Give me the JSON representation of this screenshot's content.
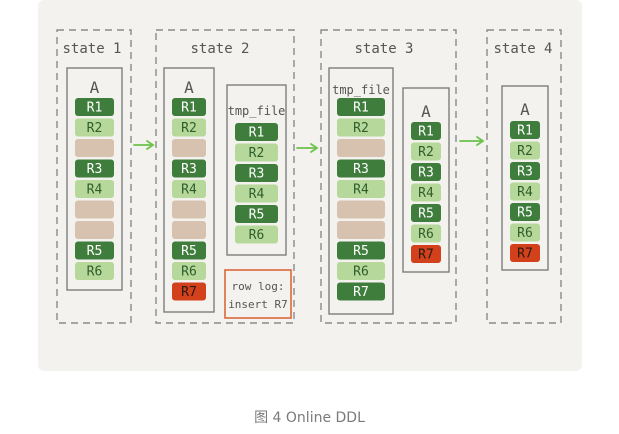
{
  "states": [
    {
      "label": "state 1"
    },
    {
      "label": "state 2"
    },
    {
      "label": "state 3"
    },
    {
      "label": "state 4"
    }
  ],
  "tables": [
    {
      "title": "A",
      "rows": [
        {
          "text": "R1",
          "kind": "dark"
        },
        {
          "text": "R2",
          "kind": "light"
        },
        {
          "text": "",
          "kind": "hole"
        },
        {
          "text": "R3",
          "kind": "dark"
        },
        {
          "text": "R4",
          "kind": "light"
        },
        {
          "text": "",
          "kind": "hole"
        },
        {
          "text": "",
          "kind": "hole"
        },
        {
          "text": "R5",
          "kind": "dark"
        },
        {
          "text": "R6",
          "kind": "light"
        }
      ]
    },
    {
      "title": "A",
      "rows": [
        {
          "text": "R1",
          "kind": "dark"
        },
        {
          "text": "R2",
          "kind": "light"
        },
        {
          "text": "",
          "kind": "hole"
        },
        {
          "text": "R3",
          "kind": "dark"
        },
        {
          "text": "R4",
          "kind": "light"
        },
        {
          "text": "",
          "kind": "hole"
        },
        {
          "text": "",
          "kind": "hole"
        },
        {
          "text": "R5",
          "kind": "dark"
        },
        {
          "text": "R6",
          "kind": "light"
        },
        {
          "text": "R7",
          "kind": "new"
        }
      ]
    },
    {
      "title": "tmp_file",
      "rows": [
        {
          "text": "R1",
          "kind": "dark"
        },
        {
          "text": "R2",
          "kind": "light"
        },
        {
          "text": "R3",
          "kind": "dark"
        },
        {
          "text": "R4",
          "kind": "light"
        },
        {
          "text": "R5",
          "kind": "dark"
        },
        {
          "text": "R6",
          "kind": "light"
        }
      ]
    },
    {
      "title": "tmp_file",
      "rows": [
        {
          "text": "R1",
          "kind": "dark"
        },
        {
          "text": "R2",
          "kind": "light"
        },
        {
          "text": "",
          "kind": "hole"
        },
        {
          "text": "R3",
          "kind": "dark"
        },
        {
          "text": "R4",
          "kind": "light"
        },
        {
          "text": "",
          "kind": "hole"
        },
        {
          "text": "",
          "kind": "hole"
        },
        {
          "text": "R5",
          "kind": "dark"
        },
        {
          "text": "R6",
          "kind": "light"
        },
        {
          "text": "R7",
          "kind": "dark"
        }
      ]
    },
    {
      "title": "A",
      "rows": [
        {
          "text": "R1",
          "kind": "dark"
        },
        {
          "text": "R2",
          "kind": "light"
        },
        {
          "text": "R3",
          "kind": "dark"
        },
        {
          "text": "R4",
          "kind": "light"
        },
        {
          "text": "R5",
          "kind": "dark"
        },
        {
          "text": "R6",
          "kind": "light"
        },
        {
          "text": "R7",
          "kind": "new"
        }
      ]
    },
    {
      "title": "A",
      "rows": [
        {
          "text": "R1",
          "kind": "dark"
        },
        {
          "text": "R2",
          "kind": "light"
        },
        {
          "text": "R3",
          "kind": "dark"
        },
        {
          "text": "R4",
          "kind": "light"
        },
        {
          "text": "R5",
          "kind": "dark"
        },
        {
          "text": "R6",
          "kind": "light"
        },
        {
          "text": "R7",
          "kind": "new"
        }
      ]
    }
  ],
  "row_log": {
    "line1": "row log:",
    "line2": "insert R7"
  },
  "caption": "图 4 Online DDL",
  "colors": {
    "panel": "#f3f2ee",
    "dark_row": "#3f7d3c",
    "light_row": "#b6d89a",
    "hole_row": "#d6c2ae",
    "new_row": "#d2401c",
    "arrow": "#6cc24a",
    "log_border": "#d9683a"
  }
}
